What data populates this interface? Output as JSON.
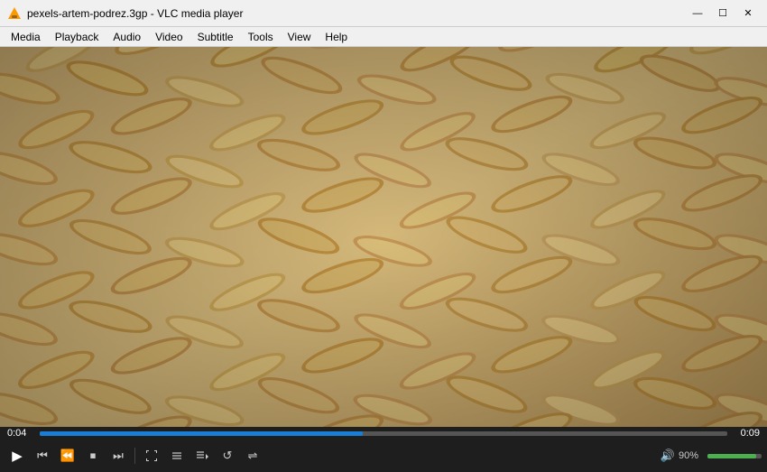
{
  "titleBar": {
    "title": "pexels-artem-podrez.3gp - VLC media player",
    "minimizeLabel": "—",
    "maximizeLabel": "☐",
    "closeLabel": "✕"
  },
  "menuBar": {
    "items": [
      "Media",
      "Playback",
      "Audio",
      "Video",
      "Subtitle",
      "Tools",
      "View",
      "Help"
    ]
  },
  "controls": {
    "timeElapsed": "0:04",
    "timeTotal": "0:09",
    "progressPercent": 47,
    "volumePercent": 90,
    "volumeLabel": "90%"
  },
  "buttons": {
    "play": "▶",
    "prev": "⏮",
    "back": "⏪",
    "next": "⏭",
    "fullscreen": "⛶",
    "togglePlaylist": "☰",
    "extendedControls": "⊞",
    "loop": "↺",
    "shuffle": "⇌",
    "stop": "⏹"
  }
}
